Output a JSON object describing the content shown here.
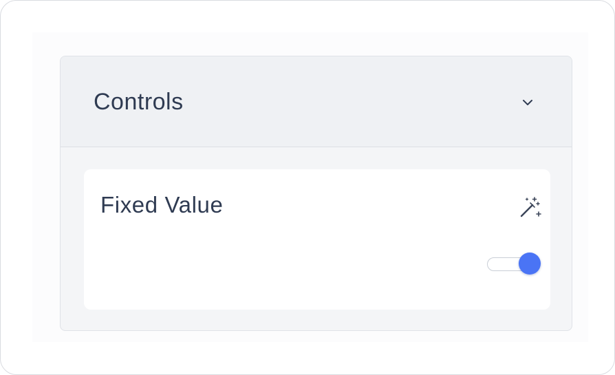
{
  "panel": {
    "title": "Controls",
    "expand_icon": "chevron-down-icon"
  },
  "control": {
    "label": "Fixed Value",
    "action_icon": "magic-wand-icon",
    "toggle": {
      "state": "on",
      "accent_color": "#4a74f5"
    }
  },
  "colors": {
    "text": "#2f3b52",
    "header_bg": "#eff1f4",
    "panel_bg": "#f4f5f7",
    "card_bg": "#ffffff"
  }
}
